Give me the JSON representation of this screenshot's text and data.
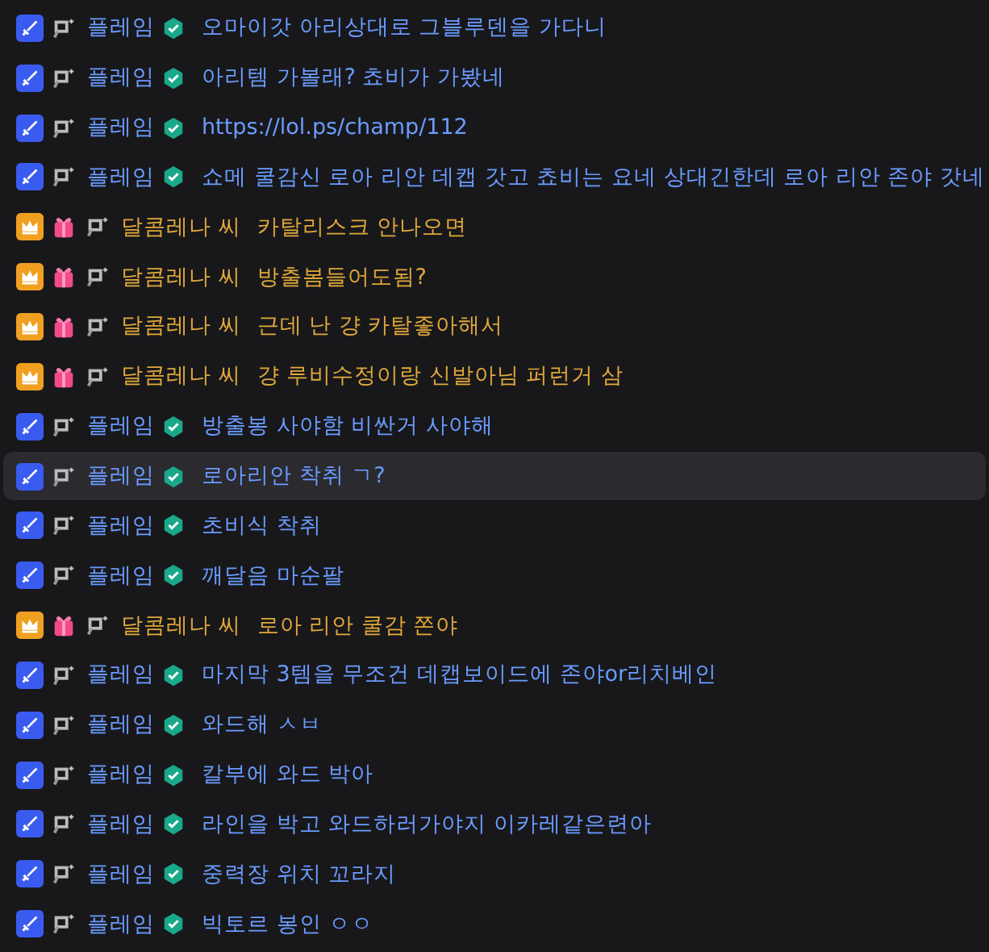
{
  "messages": [
    {
      "kind": "moderator",
      "user": "플레임",
      "color": "#6b9cff",
      "text": "오마이갓 아리상대로 그블루덴을 가다니",
      "highlighted": false
    },
    {
      "kind": "moderator",
      "user": "플레임",
      "color": "#6b9cff",
      "text": "아리템 가볼래? 쵸비가 가봤네",
      "highlighted": false
    },
    {
      "kind": "moderator",
      "user": "플레임",
      "color": "#6b9cff",
      "text": "https://lol.ps/champ/112",
      "highlighted": false
    },
    {
      "kind": "moderator",
      "user": "플레임",
      "color": "#6b9cff",
      "text": "쇼메 쿨감신 로아 리안 데캡 갓고 쵸비는 요네 상대긴한데 로아 리안 존야 갓네",
      "highlighted": false
    },
    {
      "kind": "vip",
      "user": "달콤레나 씨",
      "color": "#e0a83a",
      "text": "카탈리스크 안나오면",
      "highlighted": false
    },
    {
      "kind": "vip",
      "user": "달콤레나 씨",
      "color": "#e0a83a",
      "text": "방출봄들어도됨?",
      "highlighted": false
    },
    {
      "kind": "vip",
      "user": "달콤레나 씨",
      "color": "#e0a83a",
      "text": "근데 난 걍 카탈좋아해서",
      "highlighted": false
    },
    {
      "kind": "vip",
      "user": "달콤레나 씨",
      "color": "#e0a83a",
      "text": "걍 루비수정이랑 신발아님 퍼런거 삼",
      "highlighted": false
    },
    {
      "kind": "moderator",
      "user": "플레임",
      "color": "#6b9cff",
      "text": "방출봉 사야함 비싼거 사야해",
      "highlighted": false
    },
    {
      "kind": "moderator",
      "user": "플레임",
      "color": "#6b9cff",
      "text": "로아리안 착취 ㄱ?",
      "highlighted": true
    },
    {
      "kind": "moderator",
      "user": "플레임",
      "color": "#6b9cff",
      "text": "초비식 착취",
      "highlighted": false
    },
    {
      "kind": "moderator",
      "user": "플레임",
      "color": "#6b9cff",
      "text": "깨달음 마순팔",
      "highlighted": false
    },
    {
      "kind": "vip",
      "user": "달콤레나 씨",
      "color": "#e0a83a",
      "text": "로아 리안 쿨감 쫀야",
      "highlighted": false
    },
    {
      "kind": "moderator",
      "user": "플레임",
      "color": "#6b9cff",
      "text": "마지막 3템을 무조건 데캡보이드에 존야or리치베인",
      "highlighted": false
    },
    {
      "kind": "moderator",
      "user": "플레임",
      "color": "#6b9cff",
      "text": "와드해 ㅅㅂ",
      "highlighted": false
    },
    {
      "kind": "moderator",
      "user": "플레임",
      "color": "#6b9cff",
      "text": "칼부에 와드 박아",
      "highlighted": false
    },
    {
      "kind": "moderator",
      "user": "플레임",
      "color": "#6b9cff",
      "text": "라인을 박고 와드하러가야지 이카레같은련아",
      "highlighted": false
    },
    {
      "kind": "moderator",
      "user": "플레임",
      "color": "#6b9cff",
      "text": "중력장 위치 꼬라지",
      "highlighted": false
    },
    {
      "kind": "moderator",
      "user": "플레임",
      "color": "#6b9cff",
      "text": "빅토르 봉인 ㅇㅇ",
      "highlighted": false
    }
  ]
}
